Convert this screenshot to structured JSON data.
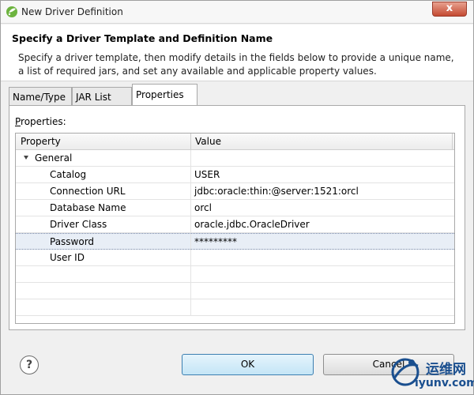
{
  "window": {
    "title": "New Driver Definition",
    "close_label": "x"
  },
  "header": {
    "title": "Specify a Driver Template and Definition Name",
    "description": "Specify a driver template, then modify details in the fields below to provide a unique name, a list of required jars, and set any available and applicable property values."
  },
  "tabs": [
    {
      "label": "Name/Type",
      "active": false
    },
    {
      "label": "JAR List",
      "active": false
    },
    {
      "label": "Properties",
      "active": true
    }
  ],
  "properties_panel": {
    "label_prefix": "P",
    "label_rest": "roperties:",
    "columns": [
      "Property",
      "Value"
    ],
    "group": "General",
    "rows": [
      {
        "property": "Catalog",
        "value": "USER"
      },
      {
        "property": "Connection URL",
        "value": "jdbc:oracle:thin:@server:1521:orcl"
      },
      {
        "property": "Database Name",
        "value": "orcl"
      },
      {
        "property": "Driver Class",
        "value": "oracle.jdbc.OracleDriver"
      },
      {
        "property": "Password",
        "value": "*********",
        "selected": true
      },
      {
        "property": "User ID",
        "value": ""
      }
    ]
  },
  "buttons": {
    "help": "?",
    "ok": "OK",
    "cancel": "Cancel"
  },
  "watermark": {
    "line1": "运维网",
    "line2": "iyunv.com"
  },
  "colors": {
    "ok_border": "#3c7fb1",
    "selected_row": "#e8eef6"
  }
}
